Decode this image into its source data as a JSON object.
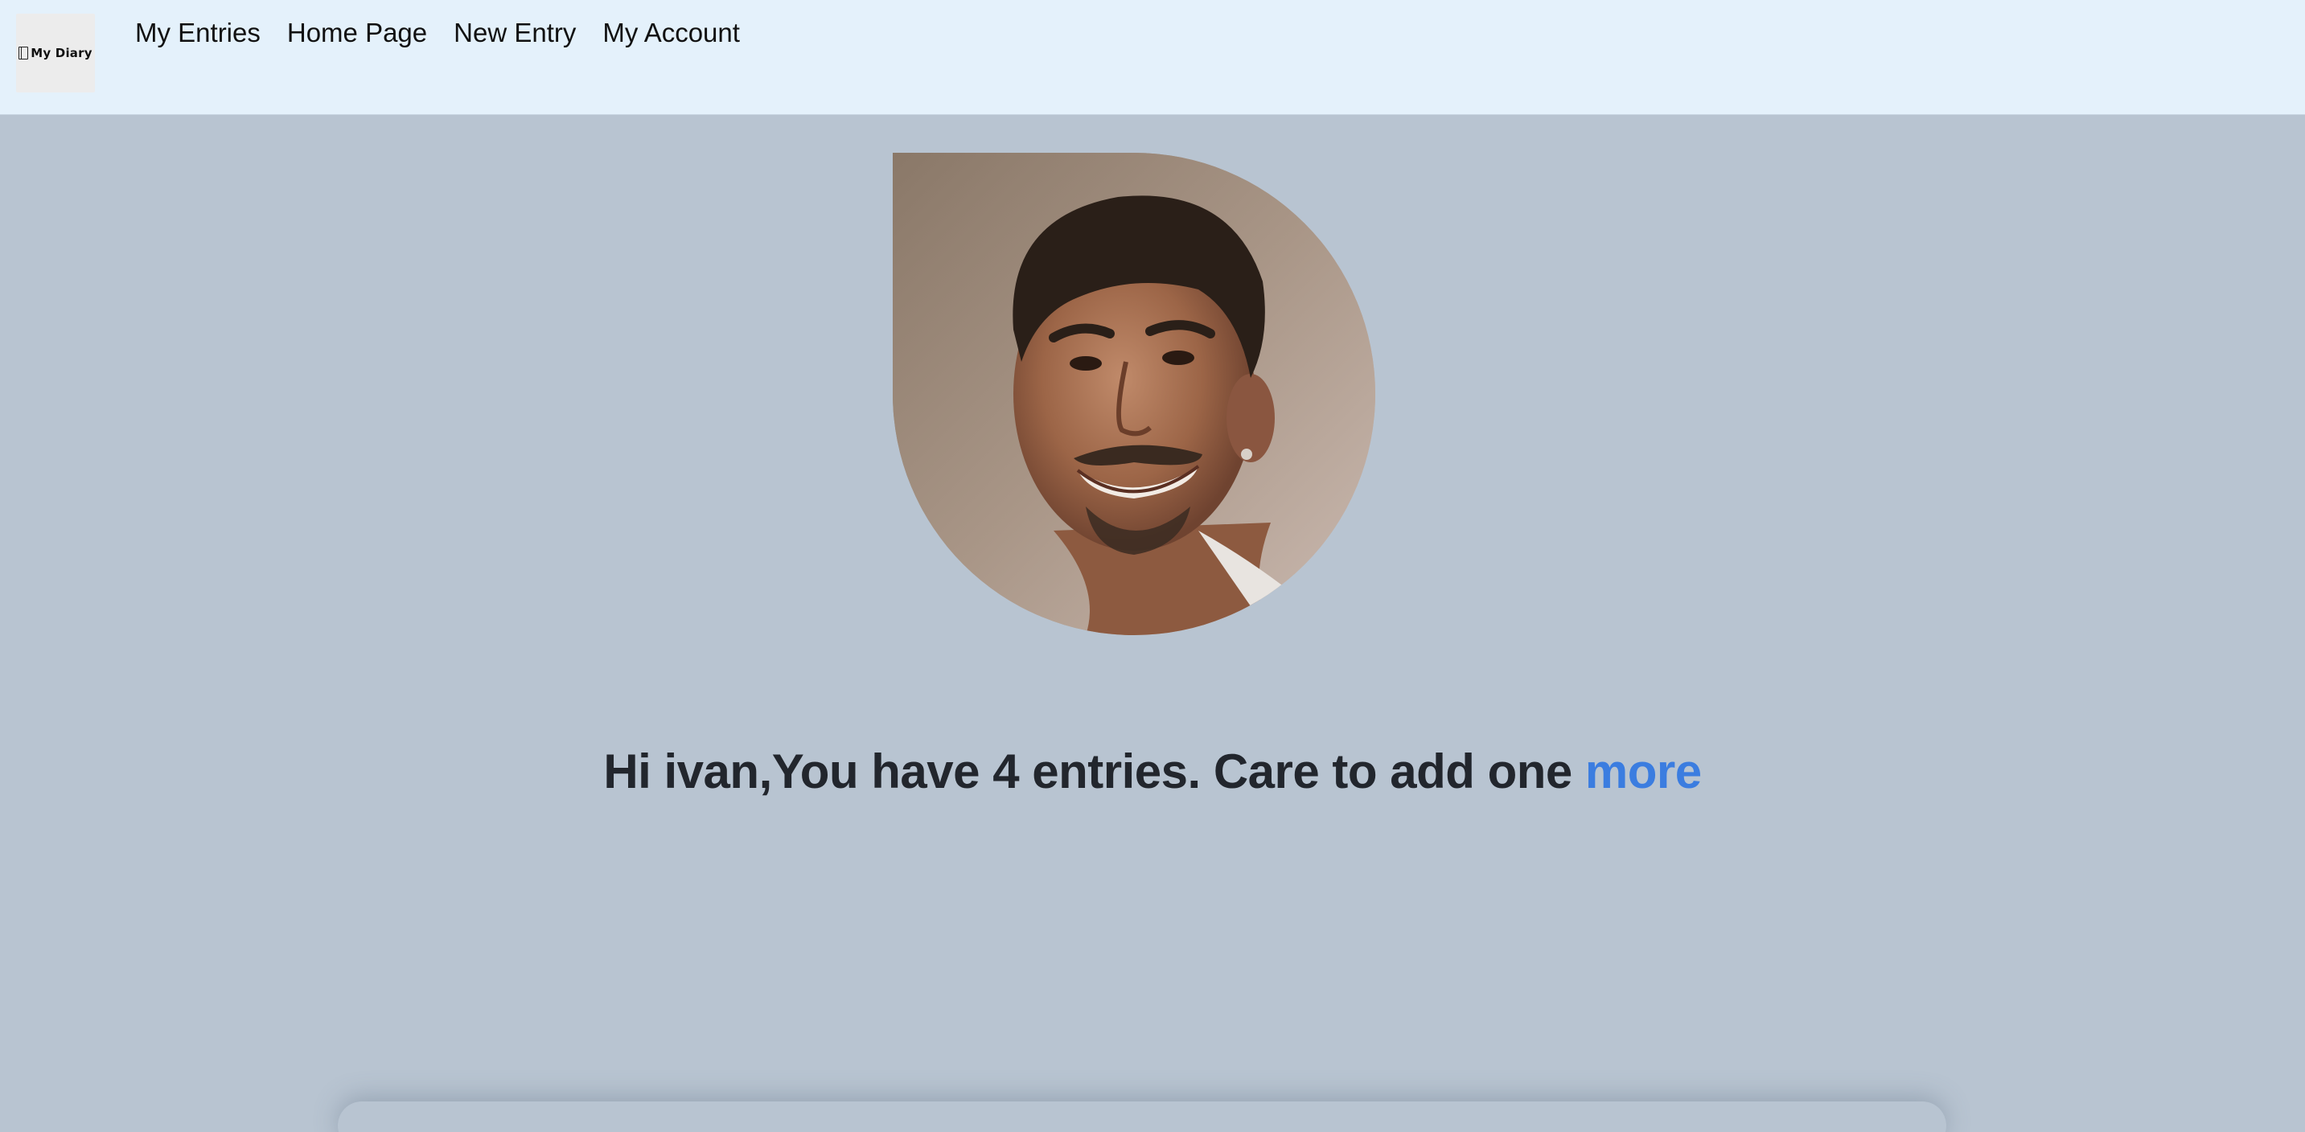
{
  "brand": {
    "logo_text": "My Diary",
    "logo_icon": "notebook-icon"
  },
  "nav": {
    "items": [
      {
        "label": "My Entries"
      },
      {
        "label": "Home Page"
      },
      {
        "label": "New Entry"
      },
      {
        "label": "My Account"
      }
    ]
  },
  "profile": {
    "avatar": "user-avatar-photo"
  },
  "greeting": {
    "text": "Hi ivan,You have 4 entries. Care to add one ",
    "link_label": "more"
  },
  "colors": {
    "navbar_bg": "#e4f1fb",
    "page_bg": "#b8c4d1",
    "link": "#3b7de0",
    "text": "#22262d"
  }
}
